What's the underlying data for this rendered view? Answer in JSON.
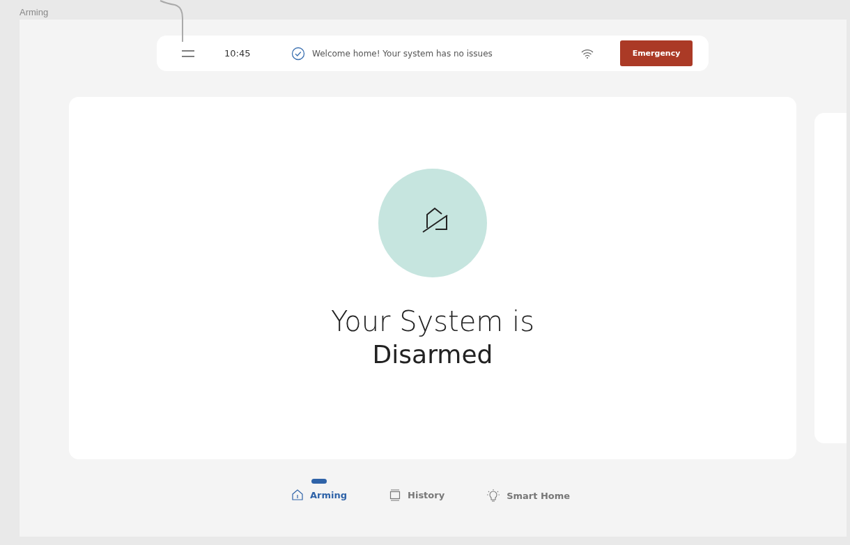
{
  "frame_label": "Arming",
  "top_bar": {
    "time": "10:45",
    "message": "Welcome home! Your system has no issues",
    "emergency_button": "Emergency"
  },
  "status": {
    "headline": "Your System is",
    "state": "Disarmed"
  },
  "tabs": [
    {
      "label": "Arming",
      "selected": true,
      "kind": "home"
    },
    {
      "label": "History",
      "selected": false,
      "kind": "history"
    },
    {
      "label": "Smart Home",
      "selected": false,
      "kind": "bulb"
    }
  ]
}
